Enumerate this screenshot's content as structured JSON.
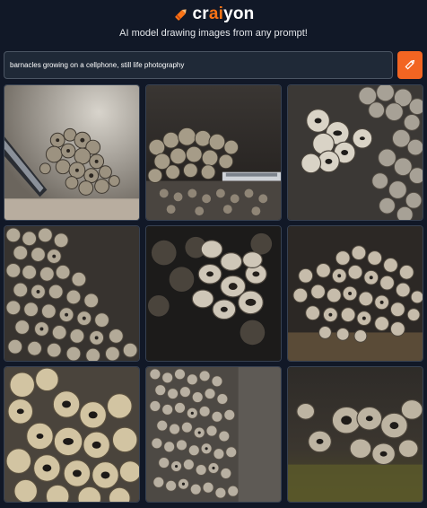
{
  "app": {
    "logo": {
      "prefix": "cr",
      "accent": "ai",
      "suffix": "yon"
    },
    "tagline": "AI model drawing images from any prompt!",
    "accent_color": "#f97316"
  },
  "prompt": {
    "value": "barnacles growing on a cellphone, still life photography",
    "button_icon": "pencil-icon"
  },
  "results": {
    "images": [
      {
        "name": "result-image-1",
        "subject": "barnacles on phone edge"
      },
      {
        "name": "result-image-2",
        "subject": "barnacles on phone screen"
      },
      {
        "name": "result-image-3",
        "subject": "barnacle cluster close-up"
      },
      {
        "name": "result-image-4",
        "subject": "barnacle colony on rock"
      },
      {
        "name": "result-image-5",
        "subject": "barnacle macro bokeh"
      },
      {
        "name": "result-image-6",
        "subject": "barnacles on dark surface"
      },
      {
        "name": "result-image-7",
        "subject": "barnacles close-up"
      },
      {
        "name": "result-image-8",
        "subject": "barnacle crust texture"
      },
      {
        "name": "result-image-9",
        "subject": "barnacles on mossy rock"
      }
    ]
  }
}
